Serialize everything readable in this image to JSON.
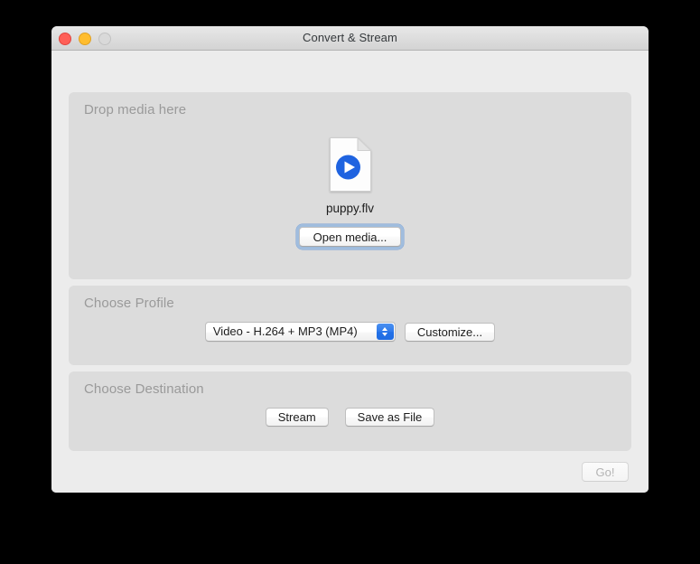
{
  "window": {
    "title": "Convert & Stream",
    "traffic_lights": [
      {
        "name": "close",
        "color": "#ff5f57"
      },
      {
        "name": "minimize",
        "color": "#ffbd2e"
      },
      {
        "name": "zoom",
        "color": "#d9d9d9"
      }
    ]
  },
  "media_panel": {
    "title": "Drop media here",
    "file_icon": "video-file-icon",
    "filename": "puppy.flv",
    "open_button": "Open media...",
    "open_button_focused": true
  },
  "profile_panel": {
    "title": "Choose Profile",
    "selected_profile": "Video - H.264 + MP3 (MP4)",
    "stepper_icon": "up-down-chevrons-icon",
    "customize_button": "Customize..."
  },
  "destination_panel": {
    "title": "Choose Destination",
    "stream_button": "Stream",
    "save_button": "Save as File"
  },
  "footer": {
    "go_button": "Go!",
    "go_button_enabled": false
  },
  "colors": {
    "window_background": "#ececec",
    "panel_background": "#dcdcdc",
    "panel_title": "#9a9a9a",
    "accent_blue": "#2f7bec",
    "play_icon_blue": "#1f63e0",
    "focus_ring": "#5696e0"
  }
}
